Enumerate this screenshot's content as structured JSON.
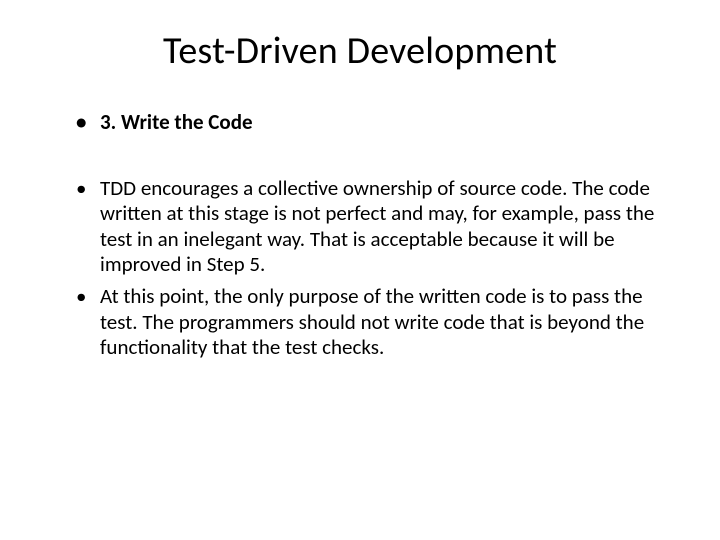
{
  "title": "Test-Driven Development",
  "bullets": [
    {
      "text": "3. Write the Code",
      "bold": true
    },
    {
      "text": "TDD encourages a collective ownership of source code. The code written at this stage is not perfect and may, for example, pass the test in an inelegant way. That is acceptable because it will be improved in Step 5.",
      "bold": false
    },
    {
      "text": "At this point, the only purpose of the written code is to pass the test. The programmers should not write code that is beyond the functionality that the test checks.",
      "bold": false
    }
  ]
}
